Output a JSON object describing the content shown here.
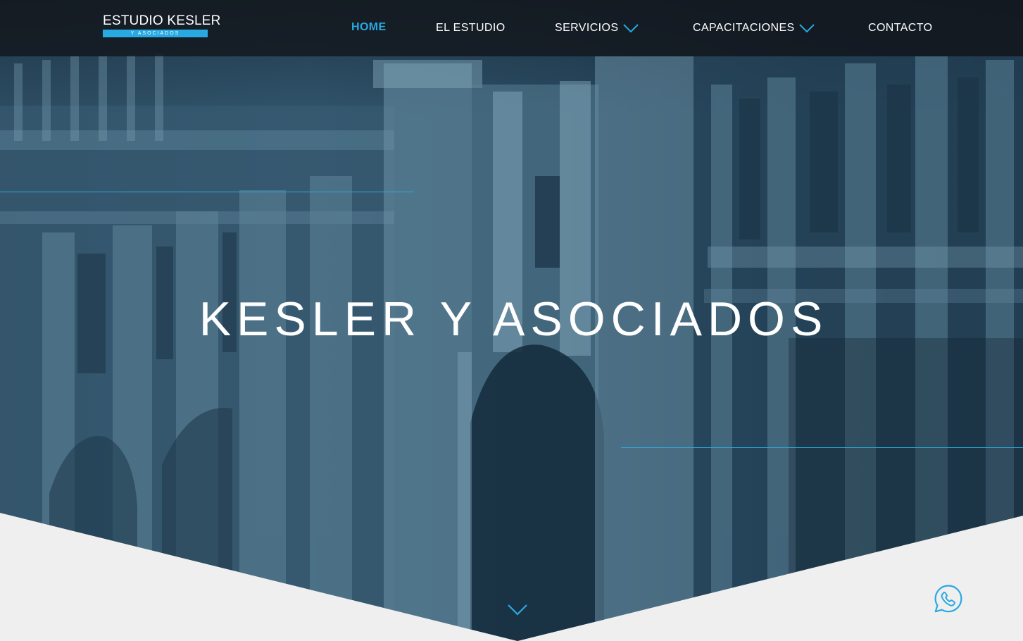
{
  "logo": {
    "main": "ESTUDIO KESLER",
    "sub": "Y ASOCIADOS"
  },
  "nav": {
    "home": "HOME",
    "estudio": "EL ESTUDIO",
    "servicios": "SERVICIOS",
    "capacitaciones": "CAPACITACIONES",
    "contacto": "CONTACTO"
  },
  "hero": {
    "title": "KESLER Y ASOCIADOS"
  },
  "icons": {
    "servicios_dropdown": "chevron-down-icon",
    "capacitaciones_dropdown": "chevron-down-icon",
    "scroll": "chevron-down-icon",
    "whatsapp": "whatsapp-icon"
  },
  "colors": {
    "accent": "#29a9e1",
    "nav_background": "#12161c",
    "hero_tint": "#2d4d63",
    "page_background": "#efefef"
  }
}
